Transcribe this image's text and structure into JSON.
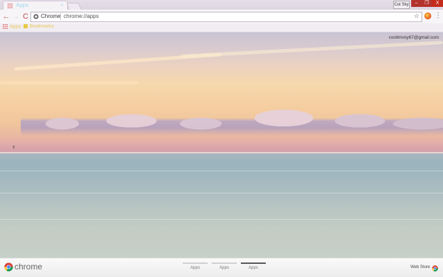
{
  "tab": {
    "title": "Apps",
    "close": "×"
  },
  "window": {
    "profile_label": "Cut Sky",
    "min": "–",
    "max": "❐",
    "close": "X"
  },
  "toolbar": {
    "back": "←",
    "forward": "→",
    "reload": "C",
    "omnibox_chip": "Chrome",
    "url": "chrome://apps",
    "star": "☆",
    "menu": "⋮"
  },
  "bookmarks": {
    "apps": "Apps",
    "folder": "Bookmarks"
  },
  "content": {
    "user_email": "cvotimvoy67@gmail.com",
    "left_nav": "‹"
  },
  "bottom": {
    "wordmark": "chrome",
    "pages": [
      "Apps",
      "Apps",
      "Apps"
    ],
    "active_page": 2,
    "webstore": "Web Store"
  },
  "colors": {
    "accent_red": "#c42b1c",
    "tab_text": "#9fd8e8",
    "bookmark_text": "#e7c95a"
  }
}
